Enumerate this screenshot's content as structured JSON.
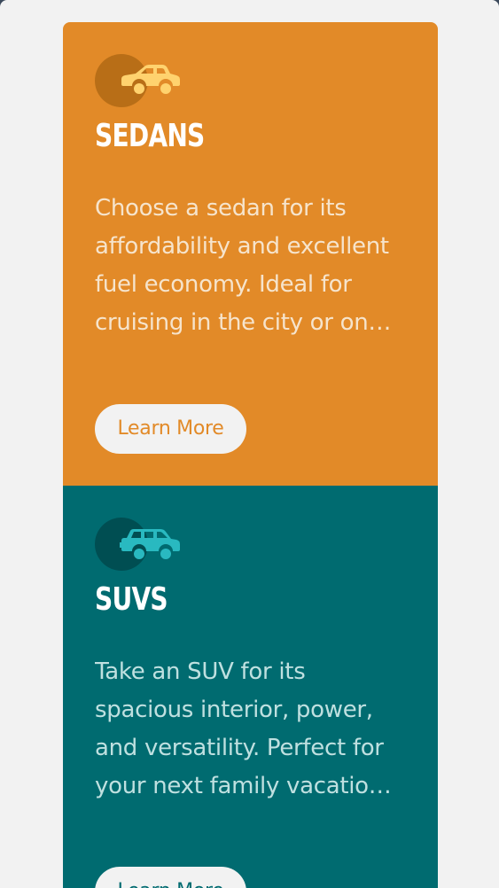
{
  "colors": {
    "page_background": "#f2f2f2",
    "sedans_card": "#e28a28",
    "sedans_icon_circle": "#b86e17",
    "sedans_icon": "#ffd26e",
    "sedans_text": "#f6e4cc",
    "sedans_button_text": "#e28a28",
    "suvs_card": "#006b70",
    "suvs_icon_circle": "#004e52",
    "suvs_icon": "#29b9c0",
    "suvs_text": "#bfe0e0",
    "suvs_button_text": "#006b70",
    "button_background": "#f2f2f2"
  },
  "cards": [
    {
      "id": "sedans",
      "icon": "sedan-car-icon",
      "title": "SEDANS",
      "text": "Choose a sedan for its affordability and excellent fuel economy. Ideal for cruising in the city or on your next road trip.",
      "button_label": "Learn More"
    },
    {
      "id": "suvs",
      "icon": "suv-car-icon",
      "title": "SUVS",
      "text": "Take an SUV for its spacious interior, power, and versatility. Perfect for your next family vacation and off-road adventures.",
      "button_label": "Learn More"
    }
  ]
}
